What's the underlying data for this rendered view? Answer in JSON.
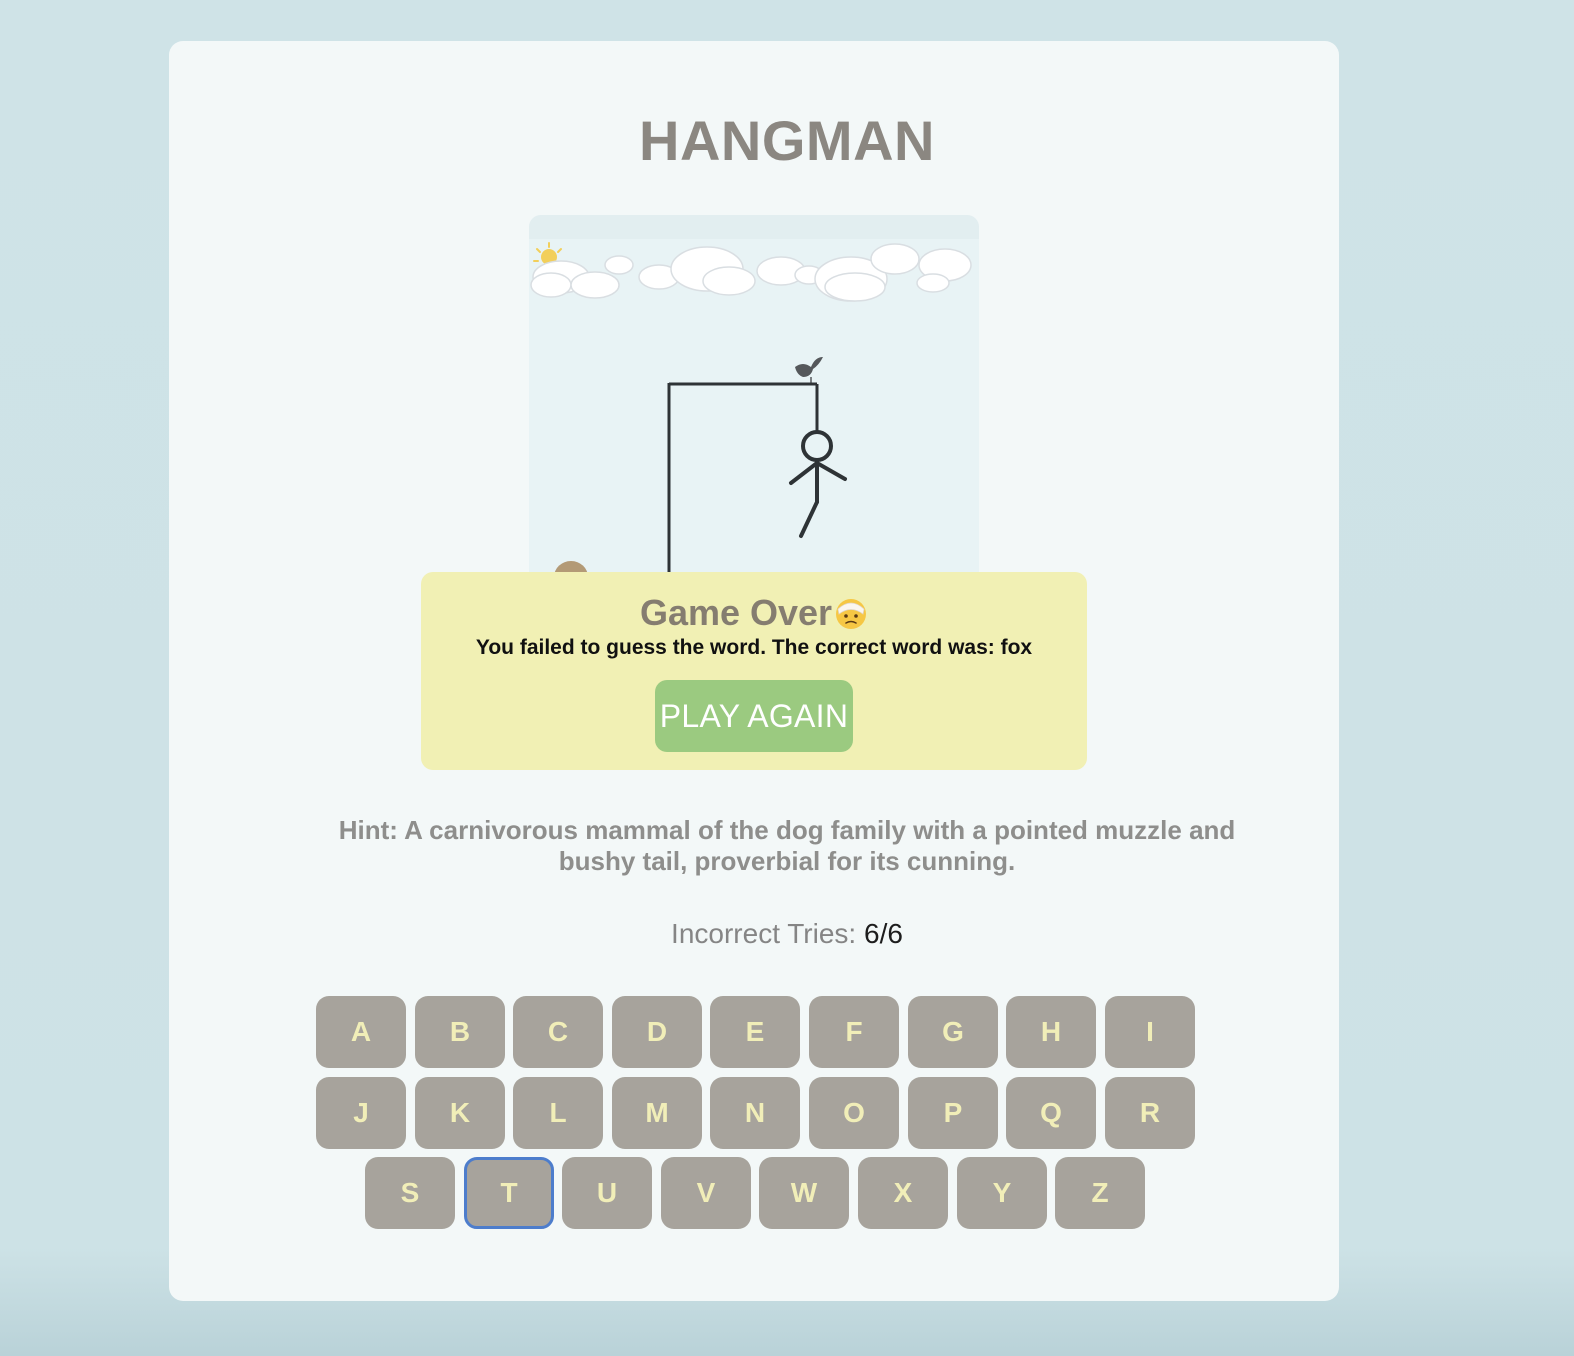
{
  "game": {
    "title": "HANGMAN"
  },
  "scene": {
    "icons": [
      "sun-icon",
      "cloud-icon",
      "bird-icon",
      "rock-icon"
    ],
    "gallows_color": "#2e3336",
    "figure_parts_shown": [
      "head",
      "body",
      "left-arm",
      "right-arm",
      "left-leg"
    ]
  },
  "game_over": {
    "heading": "Game Over",
    "emoji_icon": "face-with-head-bandage-icon",
    "message": "You failed to guess the word. The correct word was: fox",
    "play_again_label": "PLAY AGAIN"
  },
  "hint": {
    "text": "Hint: A carnivorous mammal of the dog family with a pointed muzzle and bushy tail, proverbial for its cunning."
  },
  "tries": {
    "label": "Incorrect Tries:",
    "value": "6/6"
  },
  "keyboard": {
    "rows": [
      [
        "A",
        "B",
        "C",
        "D",
        "E",
        "F",
        "G",
        "H",
        "I"
      ],
      [
        "J",
        "K",
        "L",
        "M",
        "N",
        "O",
        "P",
        "Q",
        "R"
      ],
      [
        "S",
        "T",
        "U",
        "V",
        "W",
        "X",
        "Y",
        "Z"
      ]
    ],
    "focused_key": "T"
  },
  "colors": {
    "background": "#cfe3e7",
    "card": "#f3f8f8",
    "modal": "#f1f0b4",
    "play_again": "#9bca80",
    "key": "#a7a39c",
    "key_text": "#f1eeb8",
    "focus_ring": "#4d7dcc"
  }
}
